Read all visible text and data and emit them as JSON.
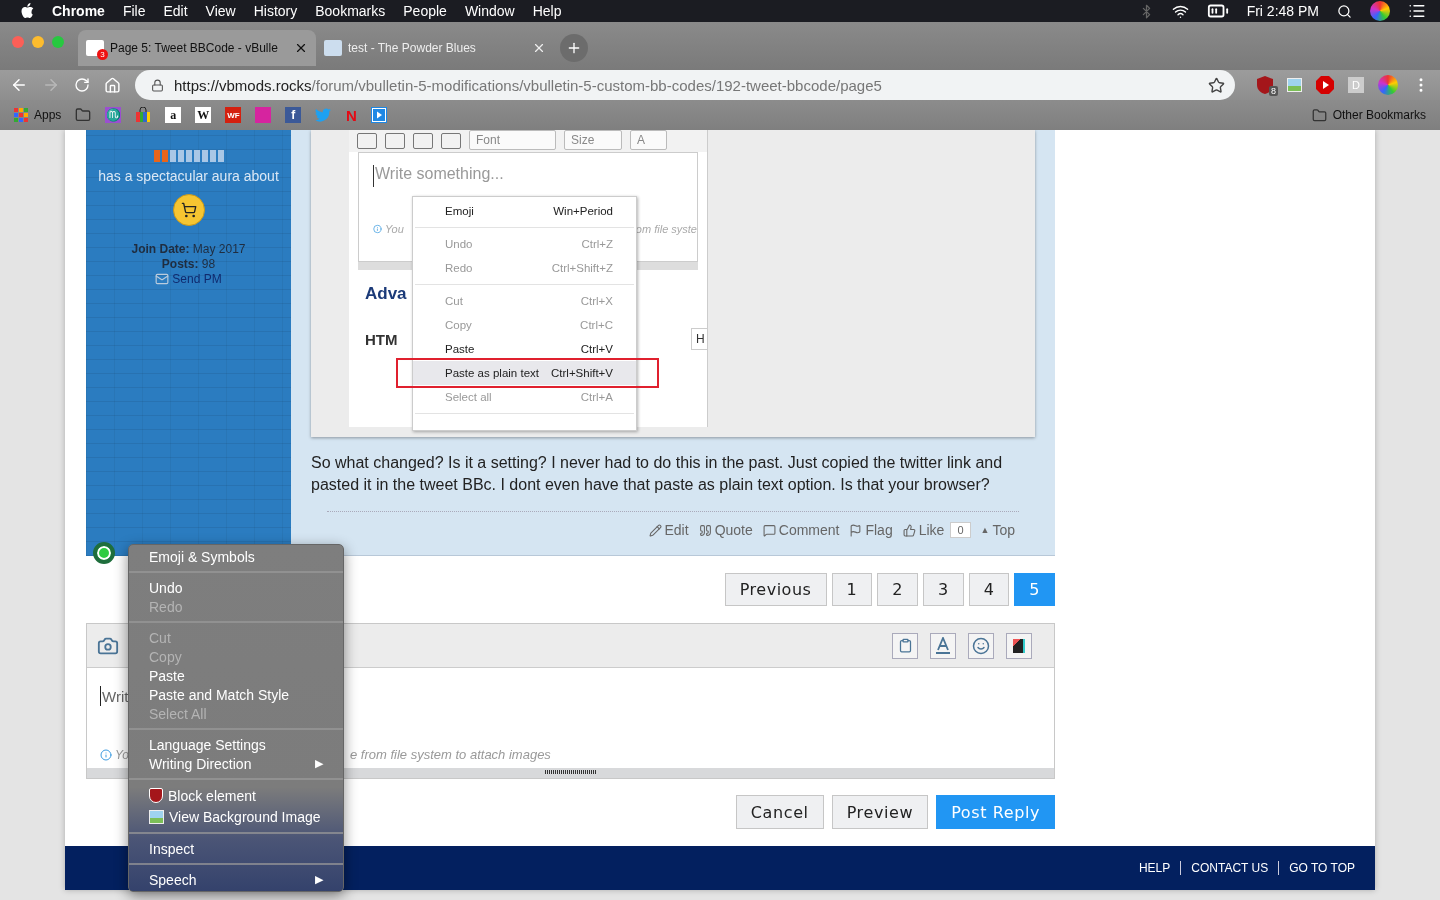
{
  "menu_bar": {
    "app": "Chrome",
    "items": [
      "File",
      "Edit",
      "View",
      "History",
      "Bookmarks",
      "People",
      "Window",
      "Help"
    ],
    "clock": "Fri 2:48 PM"
  },
  "tabs": [
    {
      "title": "Page 5: Tweet BBCode - vBulle",
      "badge": "3",
      "selected": true
    },
    {
      "title": "test - The Powder Blues",
      "selected": false
    }
  ],
  "toolbar": {
    "url_host": "https://vbmods.rocks",
    "url_path": "/forum/vbulletin-5-modifications/vbulletin-5-custom-bb-codes/192-tweet-bbcode/page5",
    "extensions": [
      {
        "kind": "shield",
        "badge": "8"
      },
      {
        "kind": "image"
      },
      {
        "kind": "play"
      },
      {
        "kind": "letter",
        "glyph": "D"
      }
    ]
  },
  "bookmarks": {
    "apps": "Apps",
    "items": [
      {
        "kind": "folder"
      },
      {
        "kind": "tile",
        "color": "#9b4fd0",
        "glyph": "♏"
      },
      {
        "kind": "bag"
      },
      {
        "kind": "tile",
        "color": "#ffffff",
        "glyph": "a"
      },
      {
        "kind": "tile",
        "color": "#ffffff",
        "glyph": "W"
      },
      {
        "kind": "tile",
        "color": "#d4200f",
        "glyph": "WF"
      },
      {
        "kind": "tile",
        "color": "#d6249f"
      },
      {
        "kind": "tile",
        "color": "#3b5998",
        "glyph": "f"
      },
      {
        "kind": "bird"
      },
      {
        "kind": "netflix",
        "glyph": "N"
      },
      {
        "kind": "play"
      }
    ],
    "other": "Other Bookmarks"
  },
  "author": {
    "reputation": {
      "level": 0.22
    },
    "title": "has a spectacular aura about",
    "join_label": "Join Date:",
    "join_value": "May 2017",
    "posts_label": "Posts:",
    "posts_value": "98",
    "send_pm": "Send PM",
    "online": true
  },
  "screenshot": {
    "toolbar": {
      "font": "Font",
      "size": "Size",
      "text_color": "A"
    },
    "placeholder": "Write something...",
    "hint_left": "You",
    "hint_right": "om file syste",
    "heading": "Adva",
    "html_label": "HTM",
    "field_text": "H",
    "menu": [
      [
        {
          "label": "Emoji",
          "shortcut": "Win+Period",
          "disabled": false,
          "selected": false
        }
      ],
      [
        {
          "label": "Undo",
          "shortcut": "Ctrl+Z",
          "disabled": true,
          "selected": false
        },
        {
          "label": "Redo",
          "shortcut": "Ctrl+Shift+Z",
          "disabled": true,
          "selected": false
        }
      ],
      [
        {
          "label": "Cut",
          "shortcut": "Ctrl+X",
          "disabled": true,
          "selected": false
        },
        {
          "label": "Copy",
          "shortcut": "Ctrl+C",
          "disabled": true,
          "selected": false
        },
        {
          "label": "Paste",
          "shortcut": "Ctrl+V",
          "disabled": false,
          "selected": false
        },
        {
          "label": "Paste as plain text",
          "shortcut": "Ctrl+Shift+V",
          "disabled": false,
          "selected": true,
          "outlined": true
        },
        {
          "label": "Select all",
          "shortcut": "Ctrl+A",
          "disabled": true,
          "selected": false
        }
      ]
    ]
  },
  "post": {
    "text": "So what changed? Is it a setting? I never had to do this in the past. Just copied the twitter link and pasted it in the tweet BBc. I dont even have that paste as plain text option. Is that your browser?",
    "actions": [
      {
        "kind": "edit",
        "label": "Edit"
      },
      {
        "kind": "quote",
        "label": "Quote"
      },
      {
        "kind": "comment",
        "label": "Comment"
      },
      {
        "kind": "flag",
        "label": "Flag"
      },
      {
        "kind": "like",
        "label": "Like"
      }
    ],
    "like_count": "0",
    "top_arrow": "▲",
    "top": "Top"
  },
  "pagination": [
    {
      "label": "Previous",
      "selected": false
    },
    {
      "label": "1",
      "selected": false
    },
    {
      "label": "2",
      "selected": false
    },
    {
      "label": "3",
      "selected": false
    },
    {
      "label": "4",
      "selected": false
    },
    {
      "label": "5",
      "selected": true
    }
  ],
  "editor": {
    "placeholder": "Writ",
    "hint_left": "Yo",
    "hint_right": "e from file system to attach images",
    "tools": [
      {
        "kind": "clipboard"
      },
      {
        "kind": "font"
      },
      {
        "kind": "emoji"
      },
      {
        "kind": "media"
      }
    ]
  },
  "buttons": [
    {
      "label": "Cancel",
      "kind": "plain"
    },
    {
      "label": "Preview",
      "kind": "plain"
    },
    {
      "label": "Post Reply",
      "kind": "primary"
    }
  ],
  "footer": [
    "HELP",
    "CONTACT US",
    "GO TO TOP"
  ],
  "context_menu": [
    [
      {
        "label": "Emoji & Symbols",
        "disabled": false,
        "kind": "plain"
      }
    ],
    [
      {
        "label": "Undo",
        "disabled": false,
        "kind": "plain"
      },
      {
        "label": "Redo",
        "disabled": true,
        "kind": "plain"
      }
    ],
    [
      {
        "label": "Cut",
        "disabled": true,
        "kind": "plain"
      },
      {
        "label": "Copy",
        "disabled": true,
        "kind": "plain"
      },
      {
        "label": "Paste",
        "disabled": false,
        "kind": "plain"
      },
      {
        "label": "Paste and Match Style",
        "disabled": false,
        "kind": "plain"
      },
      {
        "label": "Select All",
        "disabled": true,
        "kind": "plain"
      }
    ],
    [
      {
        "label": "Language Settings",
        "disabled": false,
        "kind": "plain"
      },
      {
        "label": "Writing Direction",
        "disabled": false,
        "kind": "plain",
        "arrow": "▶"
      }
    ],
    [
      {
        "label": "Block element",
        "disabled": false,
        "kind": "shield"
      },
      {
        "label": "View Background Image",
        "disabled": false,
        "kind": "image"
      }
    ],
    [
      {
        "label": "Inspect",
        "disabled": false,
        "kind": "plain"
      }
    ],
    [
      {
        "label": "Speech",
        "disabled": false,
        "kind": "plain",
        "arrow": "▶"
      }
    ]
  ]
}
